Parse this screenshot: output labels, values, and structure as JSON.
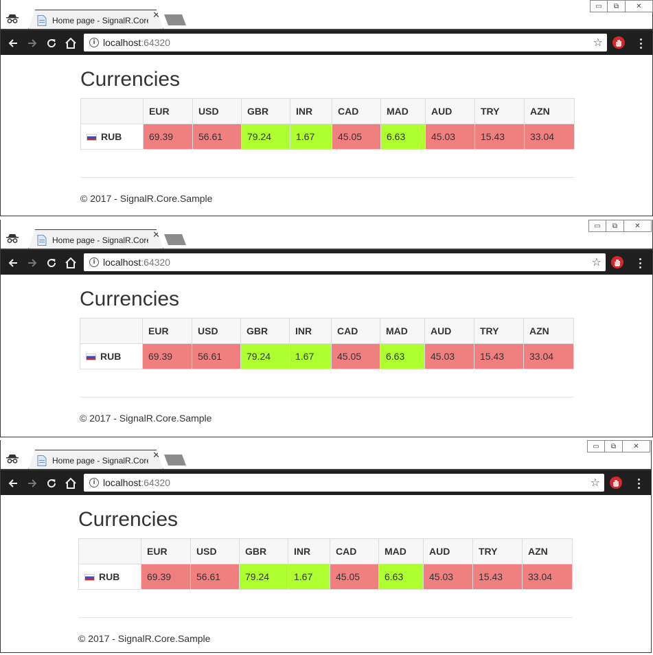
{
  "tab": {
    "title": "Home page - SignalR.Core.Sample",
    "close": "✕"
  },
  "omnibox": {
    "host": "localhost",
    "port": ":64320"
  },
  "page": {
    "title": "Currencies",
    "base_currency": "RUB",
    "columns": [
      "EUR",
      "USD",
      "GBR",
      "INR",
      "CAD",
      "MAD",
      "AUD",
      "TRY",
      "AZN"
    ],
    "rates": [
      {
        "value": "69.39",
        "trend": "down"
      },
      {
        "value": "56.61",
        "trend": "down"
      },
      {
        "value": "79.24",
        "trend": "up"
      },
      {
        "value": "1.67",
        "trend": "up"
      },
      {
        "value": "45.05",
        "trend": "down"
      },
      {
        "value": "6.63",
        "trend": "up"
      },
      {
        "value": "45.03",
        "trend": "down"
      },
      {
        "value": "15.43",
        "trend": "down"
      },
      {
        "value": "33.04",
        "trend": "down"
      }
    ],
    "footer": "© 2017 - SignalR.Core.Sample"
  },
  "colors": {
    "down": "#f08080",
    "up": "#adff2f",
    "toolbar": "#1f1f1f"
  },
  "icons": [
    "incognito-icon",
    "page-favicon-icon",
    "back-arrow-icon",
    "forward-arrow-icon",
    "reload-icon",
    "home-icon",
    "info-icon",
    "bookmark-star-icon",
    "stop-extension-icon",
    "menu-dots-icon",
    "minimize-icon",
    "maximize-icon",
    "close-icon"
  ],
  "windows": [
    {
      "id": "window-1"
    },
    {
      "id": "window-2"
    },
    {
      "id": "window-3"
    }
  ]
}
